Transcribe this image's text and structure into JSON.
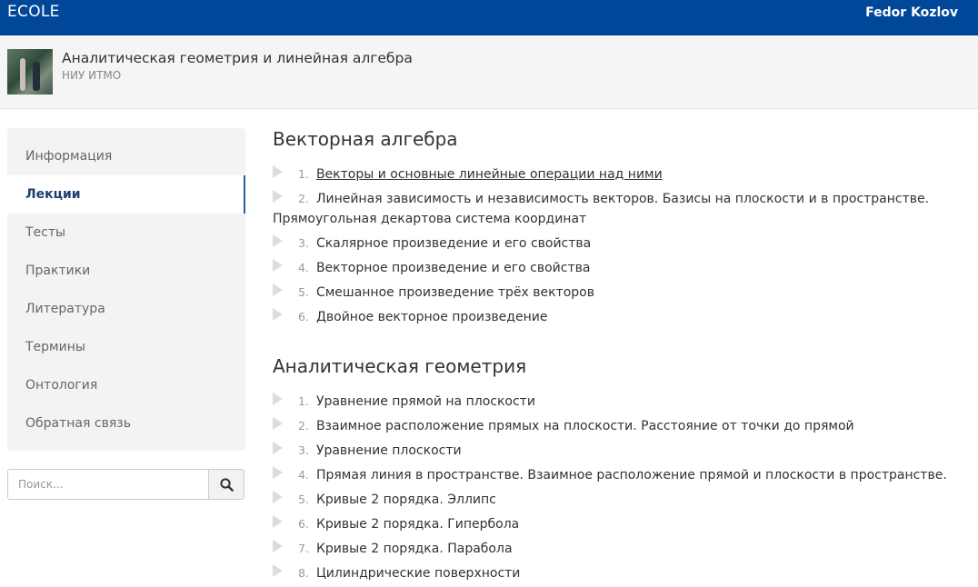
{
  "topbar": {
    "brand": "ECOLE",
    "user": "Fedor Kozlov"
  },
  "course": {
    "title": "Аналитическая геометрия и линейная алгебра",
    "org": "НИУ ИТМО"
  },
  "sidebar": {
    "items": [
      {
        "label": "Информация"
      },
      {
        "label": "Лекции",
        "active": true
      },
      {
        "label": "Тесты"
      },
      {
        "label": "Практики"
      },
      {
        "label": "Литература"
      },
      {
        "label": "Термины"
      },
      {
        "label": "Онтология"
      },
      {
        "label": "Обратная связь"
      }
    ]
  },
  "search": {
    "placeholder": "Поиск..."
  },
  "sections": [
    {
      "title": "Векторная алгебра",
      "lessons": [
        {
          "num": "1.",
          "title": "Векторы и основные линейные операции над ними"
        },
        {
          "num": "2.",
          "title": "Линейная зависимость и независимость векторов. Базисы на плоскости и в пространстве. Прямоугольная декартова система координат"
        },
        {
          "num": "3.",
          "title": "Скалярное произведение и его свойства"
        },
        {
          "num": "4.",
          "title": "Векторное произведение и его свойства"
        },
        {
          "num": "5.",
          "title": "Смешанное произведение трёх векторов"
        },
        {
          "num": "6.",
          "title": "Двойное векторное произведение"
        }
      ]
    },
    {
      "title": "Аналитическая геометрия",
      "lessons": [
        {
          "num": "1.",
          "title": "Уравнение прямой на плоскости"
        },
        {
          "num": "2.",
          "title": "Взаимное расположение прямых на плоскости. Расстояние от точки до прямой"
        },
        {
          "num": "3.",
          "title": "Уравнение плоскости"
        },
        {
          "num": "4.",
          "title": "Прямая линия в пространстве. Взаимное расположение прямой и плоскости в пространстве."
        },
        {
          "num": "5.",
          "title": "Кривые 2 порядка. Эллипс"
        },
        {
          "num": "6.",
          "title": "Кривые 2 порядка. Гипербола"
        },
        {
          "num": "7.",
          "title": "Кривые 2 порядка. Парабола"
        },
        {
          "num": "8.",
          "title": "Цилиндрические поверхности"
        }
      ]
    }
  ]
}
